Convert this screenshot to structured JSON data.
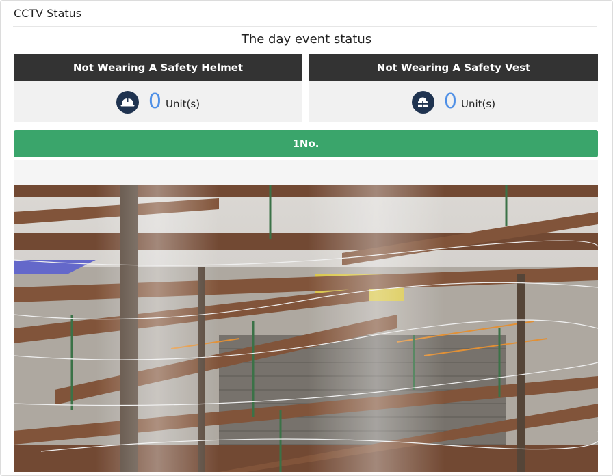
{
  "panel": {
    "title": "CCTV Status"
  },
  "event_status": {
    "title": "The day event status",
    "cards": [
      {
        "label": "Not Wearing A Safety Helmet",
        "count": "0",
        "unit": "Unit(s)",
        "icon": "hard-hat-icon"
      },
      {
        "label": "Not Wearing A Safety Vest",
        "count": "0",
        "unit": "Unit(s)",
        "icon": "safety-vest-icon"
      }
    ]
  },
  "camera": {
    "number_label": "1No."
  },
  "colors": {
    "header_dark": "#333333",
    "card_background": "#f1f1f1",
    "count_blue": "#4e8fe6",
    "icon_navy": "#1f3350",
    "accent_green": "#3aa56b"
  }
}
